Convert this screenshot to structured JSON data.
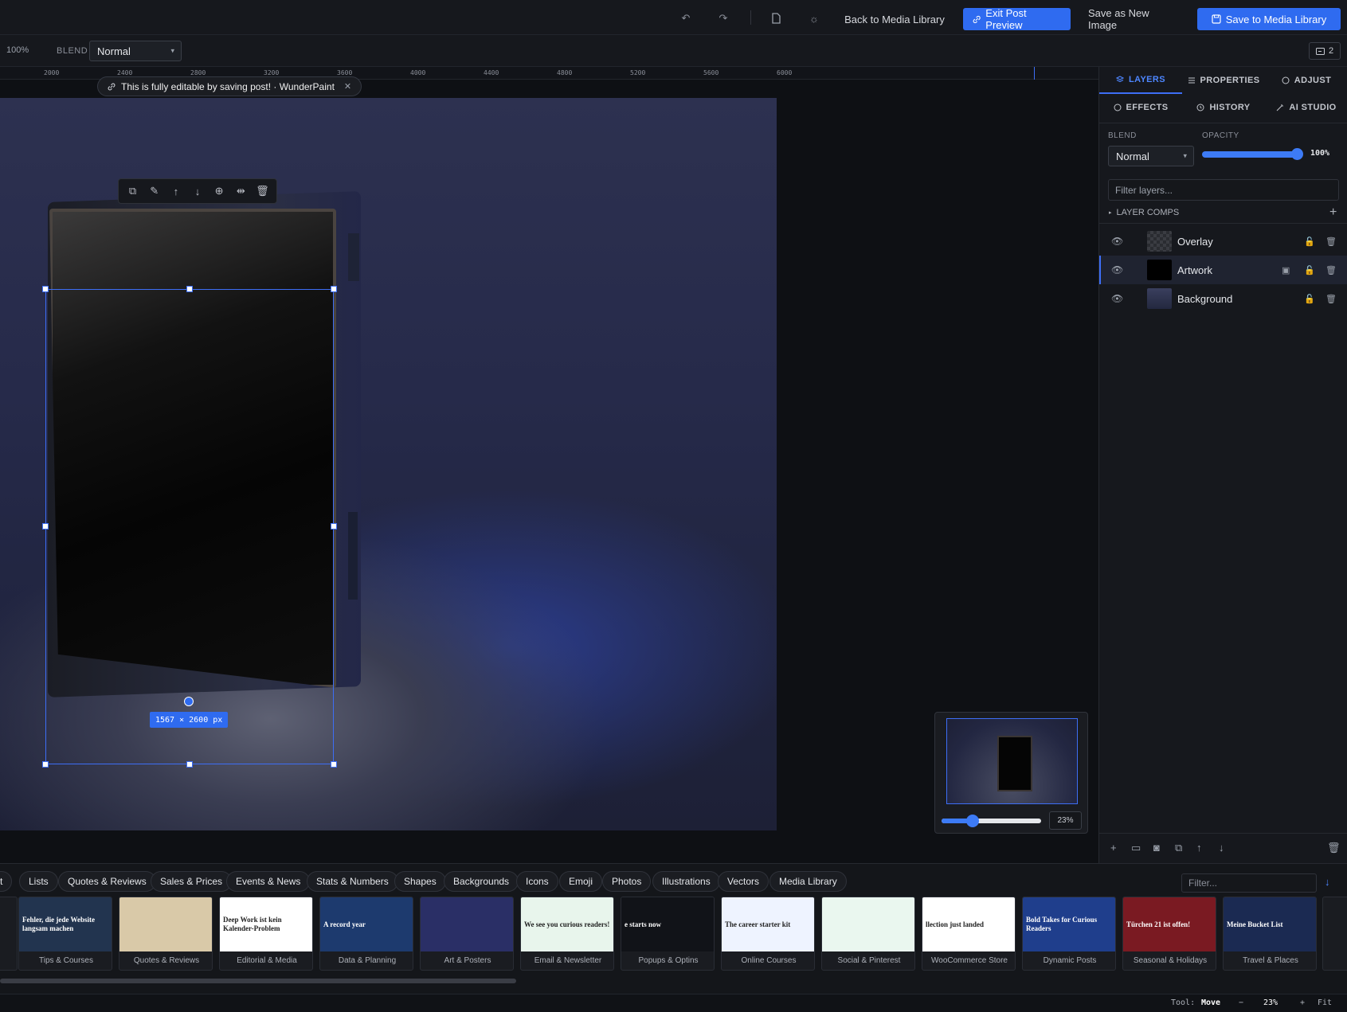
{
  "topbar": {
    "back_label": "Back to Media Library",
    "exit_preview_label": "Exit Post Preview",
    "save_new_label": "Save as New Image",
    "save_library_label": "Save to Media Library"
  },
  "toolbar": {
    "zoom_text": "100%",
    "blend_label": "BLEND",
    "blend_value": "Normal",
    "counter": "2"
  },
  "ruler": {
    "ticks": [
      "2000",
      "2400",
      "2800",
      "3200",
      "3600",
      "4000",
      "4400",
      "4800",
      "5200",
      "5600",
      "6000"
    ]
  },
  "notice": {
    "text": "This is fully editable by saving post! · WunderPaint"
  },
  "selection": {
    "dimensions": "1567 × 2600 px"
  },
  "minimap": {
    "zoom": "23%",
    "zoom_fraction": 0.23
  },
  "panel": {
    "tabs": [
      "LAYERS",
      "PROPERTIES",
      "ADJUST",
      "EFFECTS",
      "HISTORY",
      "AI STUDIO"
    ],
    "blend_label": "BLEND",
    "blend_value": "Normal",
    "opacity_label": "OPACITY",
    "opacity_value": "100%",
    "filter_placeholder": "Filter layers...",
    "layer_comps": "LAYER COMPS",
    "layers": [
      {
        "name": "Overlay",
        "selected": false
      },
      {
        "name": "Artwork",
        "selected": true
      },
      {
        "name": "Background",
        "selected": false
      }
    ]
  },
  "assets": {
    "categories": [
      "rt",
      "Lists",
      "Quotes & Reviews",
      "Sales & Prices",
      "Events & News",
      "Stats & Numbers",
      "Shapes",
      "Backgrounds",
      "Icons",
      "Emoji",
      "Photos",
      "Illustrations",
      "Vectors",
      "Media Library"
    ],
    "filter_placeholder": "Filter...",
    "cards": [
      {
        "caption": "Tips & Courses",
        "thumb_text": "Fehler, die jede Website langsam machen",
        "bg": "#22344f"
      },
      {
        "caption": "Quotes & Reviews",
        "thumb_text": "",
        "bg": "#d9c9a8"
      },
      {
        "caption": "Editorial & Media",
        "thumb_text": "Deep Work ist kein Kalender-Problem",
        "bg": "#ffffff"
      },
      {
        "caption": "Data & Planning",
        "thumb_text": "A record year",
        "bg": "#1d3a6e"
      },
      {
        "caption": "Art & Posters",
        "thumb_text": "",
        "bg": "#2a2f66"
      },
      {
        "caption": "Email & Newsletter",
        "thumb_text": "We see you curious readers!",
        "bg": "#e8f5ec"
      },
      {
        "caption": "Popups & Optins",
        "thumb_text": "e starts now",
        "bg": "#111318"
      },
      {
        "caption": "Online Courses",
        "thumb_text": "The career starter kit",
        "bg": "#eef3ff"
      },
      {
        "caption": "Social & Pinterest",
        "thumb_text": "",
        "bg": "#eaf7ef"
      },
      {
        "caption": "WooCommerce Store",
        "thumb_text": "llection just landed",
        "bg": "#ffffff"
      },
      {
        "caption": "Dynamic Posts",
        "thumb_text": "Bold Takes for Curious Readers",
        "bg": "#1f3e8c"
      },
      {
        "caption": "Seasonal & Holidays",
        "thumb_text": "Türchen 21 ist offen!",
        "bg": "#7a1a22"
      },
      {
        "caption": "Travel & Places",
        "thumb_text": "Meine Bucket List",
        "bg": "#1b2a52"
      }
    ]
  },
  "status": {
    "tool_label": "Tool:",
    "tool_value": "Move",
    "minus": "−",
    "zoom": "23%",
    "plus": "+",
    "fit": "Fit"
  }
}
